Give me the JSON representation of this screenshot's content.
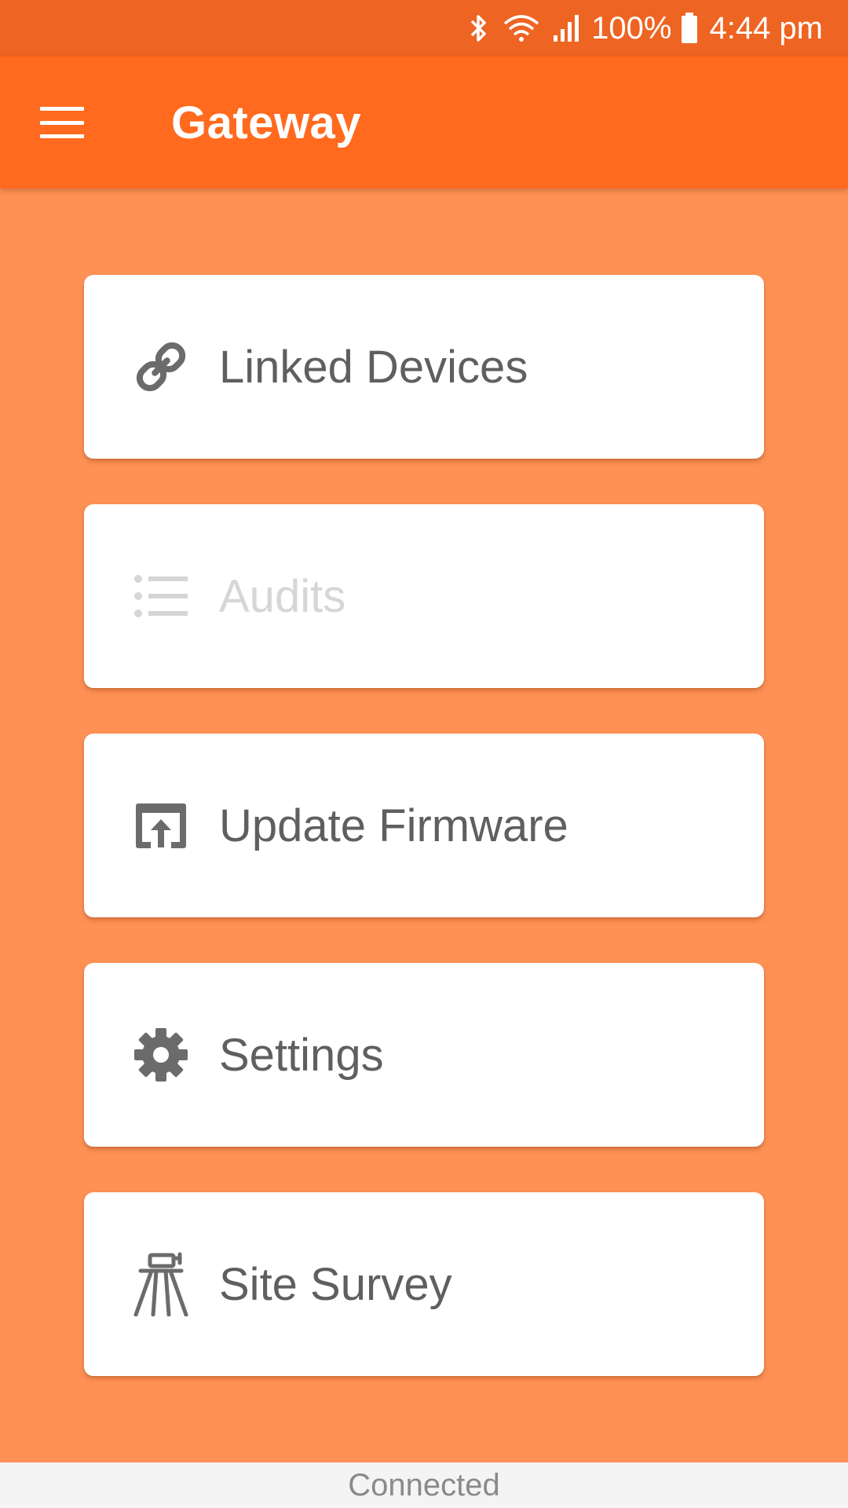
{
  "status_bar": {
    "battery": "100%",
    "time": "4:44 pm",
    "icons": [
      "bluetooth-icon",
      "wifi-icon",
      "signal-icon",
      "battery-icon"
    ]
  },
  "app_bar": {
    "title": "Gateway",
    "menu_icon": "hamburger-menu-icon"
  },
  "menu": {
    "items": [
      {
        "label": "Linked Devices",
        "icon": "link-icon",
        "enabled": true
      },
      {
        "label": "Audits",
        "icon": "list-icon",
        "enabled": false
      },
      {
        "label": "Update Firmware",
        "icon": "upload-icon",
        "enabled": true
      },
      {
        "label": "Settings",
        "icon": "gear-icon",
        "enabled": true
      },
      {
        "label": "Site Survey",
        "icon": "surveyor-tripod-icon",
        "enabled": true
      }
    ]
  },
  "footer": {
    "connection_status": "Connected"
  },
  "colors": {
    "status_bar": "#EE6422",
    "app_bar": "#FF6A1F",
    "background": "#FF9155",
    "card": "#FFFFFF",
    "icon_enabled": "#6B6B6B",
    "icon_disabled": "#D6D6D6"
  }
}
